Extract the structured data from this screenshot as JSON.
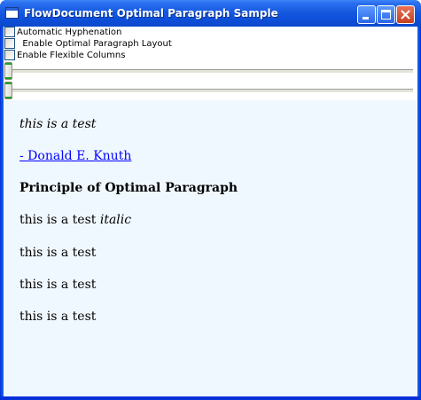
{
  "window": {
    "title": "FlowDocument Optimal Paragraph Sample",
    "icon": "window-app-icon"
  },
  "options": [
    {
      "label": "Automatic Hyphenation",
      "checked": false
    },
    {
      "label": "  Enable Optimal Paragraph Layout",
      "checked": false
    },
    {
      "label": "Enable Flexible Columns",
      "checked": false
    }
  ],
  "sliders": [
    {
      "value": 0
    },
    {
      "value": 0
    }
  ],
  "document": {
    "paragraphs": [
      {
        "text": "this is a test"
      },
      {
        "text": "- Donald E. Knuth"
      },
      {
        "text": "Principle of Optimal Paragraph"
      },
      {
        "text": "this is a test ",
        "italic_text": "italic"
      },
      {
        "text": "this is a test"
      },
      {
        "text": "this is a test"
      },
      {
        "text": "this is a test"
      }
    ]
  },
  "colors": {
    "titlebar": "#0d4ed8",
    "document_background": "#f0f8ff",
    "link": "#0000ff"
  }
}
